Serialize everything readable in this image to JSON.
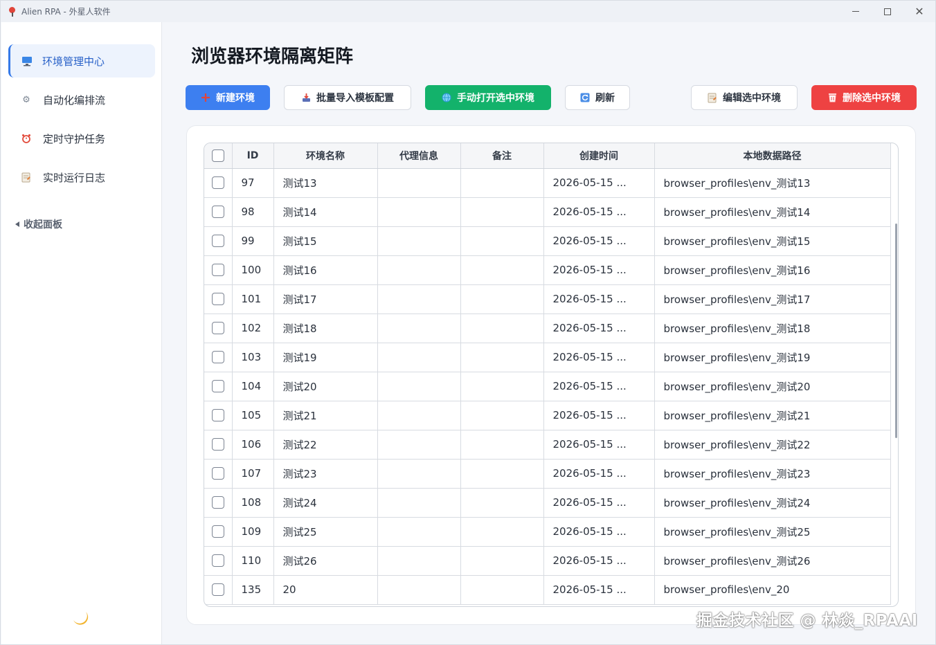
{
  "window": {
    "title": "Alien RPA - 外星人软件"
  },
  "sidebar": {
    "items": [
      {
        "label": "环境管理中心",
        "icon": "monitor-icon",
        "active": true
      },
      {
        "label": "自动化编排流",
        "icon": "gear-icon",
        "active": false
      },
      {
        "label": "定时守护任务",
        "icon": "alarm-clock-icon",
        "active": false
      },
      {
        "label": "实时运行日志",
        "icon": "memo-icon",
        "active": false
      }
    ],
    "collapse_label": "收起面板",
    "theme_icon": "moon-icon"
  },
  "page": {
    "title": "浏览器环境隔离矩阵"
  },
  "toolbar": {
    "new_env": "新建环境",
    "batch_import": "批量导入模板配置",
    "open_selected": "手动打开选中环境",
    "refresh": "刷新",
    "edit_selected": "编辑选中环境",
    "delete_selected": "删除选中环境"
  },
  "colors": {
    "primary": "#3d7ff0",
    "success": "#13b26b",
    "danger": "#ee4242"
  },
  "table": {
    "headers": [
      "ID",
      "环境名称",
      "代理信息",
      "备注",
      "创建时间",
      "本地数据路径"
    ],
    "rows": [
      [
        "97",
        "测试13",
        "",
        "",
        "2026-05-15 ...",
        "browser_profiles\\env_测试13"
      ],
      [
        "98",
        "测试14",
        "",
        "",
        "2026-05-15 ...",
        "browser_profiles\\env_测试14"
      ],
      [
        "99",
        "测试15",
        "",
        "",
        "2026-05-15 ...",
        "browser_profiles\\env_测试15"
      ],
      [
        "100",
        "测试16",
        "",
        "",
        "2026-05-15 ...",
        "browser_profiles\\env_测试16"
      ],
      [
        "101",
        "测试17",
        "",
        "",
        "2026-05-15 ...",
        "browser_profiles\\env_测试17"
      ],
      [
        "102",
        "测试18",
        "",
        "",
        "2026-05-15 ...",
        "browser_profiles\\env_测试18"
      ],
      [
        "103",
        "测试19",
        "",
        "",
        "2026-05-15 ...",
        "browser_profiles\\env_测试19"
      ],
      [
        "104",
        "测试20",
        "",
        "",
        "2026-05-15 ...",
        "browser_profiles\\env_测试20"
      ],
      [
        "105",
        "测试21",
        "",
        "",
        "2026-05-15 ...",
        "browser_profiles\\env_测试21"
      ],
      [
        "106",
        "测试22",
        "",
        "",
        "2026-05-15 ...",
        "browser_profiles\\env_测试22"
      ],
      [
        "107",
        "测试23",
        "",
        "",
        "2026-05-15 ...",
        "browser_profiles\\env_测试23"
      ],
      [
        "108",
        "测试24",
        "",
        "",
        "2026-05-15 ...",
        "browser_profiles\\env_测试24"
      ],
      [
        "109",
        "测试25",
        "",
        "",
        "2026-05-15 ...",
        "browser_profiles\\env_测试25"
      ],
      [
        "110",
        "测试26",
        "",
        "",
        "2026-05-15 ...",
        "browser_profiles\\env_测试26"
      ],
      [
        "135",
        "20",
        "",
        "",
        "2026-05-15 ...",
        "browser_profiles\\env_20"
      ]
    ]
  },
  "watermark": "掘金技术社区 @ 林焱_RPAAI"
}
